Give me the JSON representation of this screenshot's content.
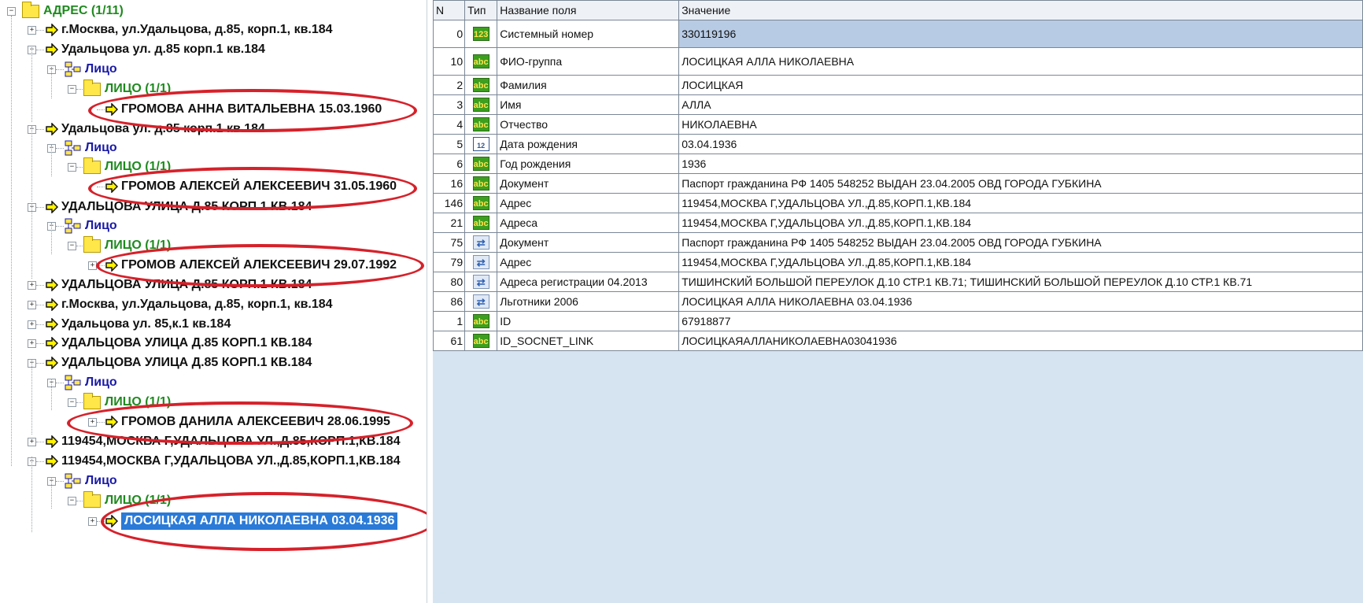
{
  "tree": {
    "root_label": "АДРЕС (1/11)",
    "nodes": [
      {
        "label": "г.Москва, ул.Удальцова, д.85, корп.1, кв.184"
      },
      {
        "label": "Удальцова ул. д.85 корп.1 кв.184"
      },
      {
        "label": "Лицо"
      },
      {
        "label": "ЛИЦО (1/1)"
      },
      {
        "label": "ГРОМОВА АННА ВИТАЛЬЕВНА 15.03.1960"
      },
      {
        "label": "Удальцова ул. д.85 корп.1 кв.184"
      },
      {
        "label": "Лицо"
      },
      {
        "label": "ЛИЦО (1/1)"
      },
      {
        "label": "ГРОМОВ АЛЕКСЕЙ АЛЕКСЕЕВИЧ 31.05.1960"
      },
      {
        "label": "УДАЛЬЦОВА УЛИЦА Д.85 КОРП.1 КВ.184"
      },
      {
        "label": "Лицо"
      },
      {
        "label": "ЛИЦО (1/1)"
      },
      {
        "label": "ГРОМОВ АЛЕКСЕЙ АЛЕКСЕЕВИЧ 29.07.1992"
      },
      {
        "label": "УДАЛЬЦОВА УЛИЦА Д.85 КОРП.1 КВ.184"
      },
      {
        "label": "г.Москва, ул.Удальцова, д.85, корп.1, кв.184"
      },
      {
        "label": "Удальцова ул. 85,к.1 кв.184"
      },
      {
        "label": "УДАЛЬЦОВА УЛИЦА Д.85 КОРП.1 КВ.184"
      },
      {
        "label": "УДАЛЬЦОВА УЛИЦА Д.85 КОРП.1 КВ.184"
      },
      {
        "label": "Лицо"
      },
      {
        "label": "ЛИЦО (1/1)"
      },
      {
        "label": "ГРОМОВ ДАНИЛА АЛЕКСЕЕВИЧ 28.06.1995"
      },
      {
        "label": "119454,МОСКВА Г,УДАЛЬЦОВА УЛ.,Д.85,КОРП.1,КВ.184"
      },
      {
        "label": "119454,МОСКВА Г,УДАЛЬЦОВА УЛ.,Д.85,КОРП.1,КВ.184"
      },
      {
        "label": "Лицо"
      },
      {
        "label": "ЛИЦО (1/1)"
      },
      {
        "label": "ЛОСИЦКАЯ АЛЛА НИКОЛАЕВНА 03.04.1936"
      }
    ]
  },
  "grid": {
    "columns": {
      "n": "N",
      "type": "Тип",
      "field": "Название поля",
      "value": "Значение"
    },
    "type_icons": {
      "num": "123",
      "abc": "abc",
      "date": "12",
      "link": "⇄"
    },
    "rows": [
      {
        "n": "0",
        "type": "num",
        "field": "Системный номер",
        "value": "330119196"
      },
      {
        "n": "10",
        "type": "abc",
        "field": "ФИО-группа",
        "value": "ЛОСИЦКАЯ АЛЛА НИКОЛАЕВНА"
      },
      {
        "n": "2",
        "type": "abc",
        "field": "Фамилия",
        "value": "ЛОСИЦКАЯ"
      },
      {
        "n": "3",
        "type": "abc",
        "field": "Имя",
        "value": "АЛЛА"
      },
      {
        "n": "4",
        "type": "abc",
        "field": "Отчество",
        "value": "НИКОЛАЕВНА"
      },
      {
        "n": "5",
        "type": "date",
        "field": "Дата рождения",
        "value": "03.04.1936"
      },
      {
        "n": "6",
        "type": "abc",
        "field": "Год рождения",
        "value": "1936"
      },
      {
        "n": "16",
        "type": "abc",
        "field": "Документ",
        "value": "Паспорт гражданина РФ 1405 548252 ВЫДАН 23.04.2005 ОВД ГОРОДА ГУБКИНА"
      },
      {
        "n": "146",
        "type": "abc",
        "field": "Адрес",
        "value": "119454,МОСКВА Г,УДАЛЬЦОВА УЛ.,Д.85,КОРП.1,КВ.184"
      },
      {
        "n": "21",
        "type": "abc",
        "field": "Адреса",
        "value": "119454,МОСКВА Г,УДАЛЬЦОВА УЛ.,Д.85,КОРП.1,КВ.184"
      },
      {
        "n": "75",
        "type": "link",
        "field": "Документ",
        "value": "Паспорт гражданина РФ 1405 548252 ВЫДАН 23.04.2005 ОВД ГОРОДА ГУБКИНА"
      },
      {
        "n": "79",
        "type": "link",
        "field": "Адрес",
        "value": "119454,МОСКВА Г,УДАЛЬЦОВА УЛ.,Д.85,КОРП.1,КВ.184"
      },
      {
        "n": "80",
        "type": "link",
        "field": "Адреса регистрации 04.2013",
        "value": "ТИШИНСКИЙ БОЛЬШОЙ ПЕРЕУЛОК Д.10 СТР.1 КВ.71; ТИШИНСКИЙ БОЛЬШОЙ ПЕРЕУЛОК Д.10 СТР.1 КВ.71"
      },
      {
        "n": "86",
        "type": "link",
        "field": "Льготники 2006",
        "value": "ЛОСИЦКАЯ АЛЛА НИКОЛАЕВНА 03.04.1936"
      },
      {
        "n": "1",
        "type": "abc",
        "field": "ID",
        "value": "67918877"
      },
      {
        "n": "61",
        "type": "abc",
        "field": "ID_SOCNET_LINK",
        "value": "ЛОСИЦКАЯАЛЛАНИКОЛАЕВНА03041936"
      }
    ]
  },
  "colors": {
    "highlight_oval": "#d6212a",
    "selection": "#2a7ad8",
    "green_label": "#1f8a1f",
    "blue_label": "#1a1aa8"
  }
}
